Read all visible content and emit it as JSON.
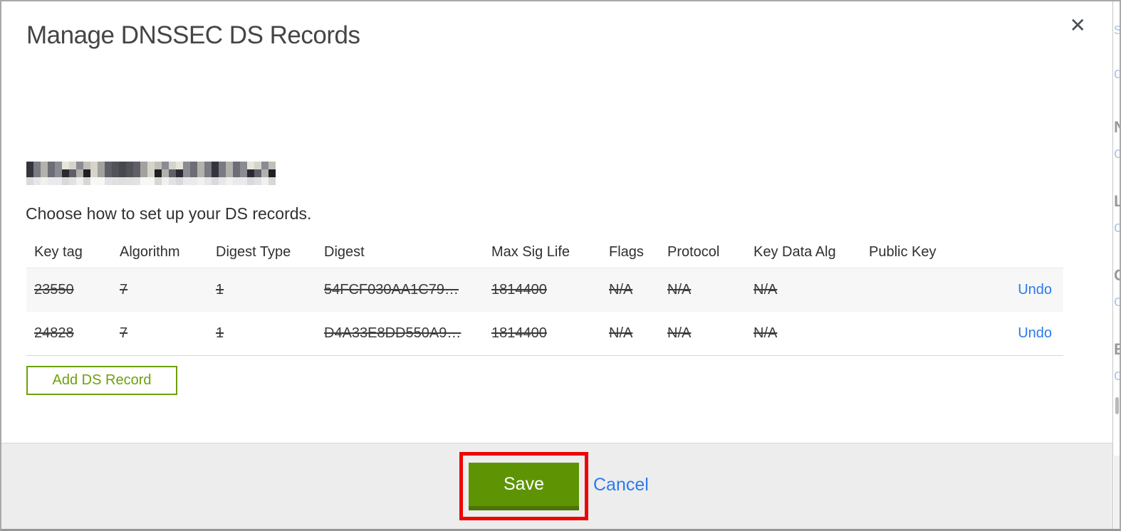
{
  "modal": {
    "title": "Manage DNSSEC DS Records",
    "close_glyph": "✕",
    "subtitle": "Choose how to set up your DS records.",
    "domain": {
      "redacted": true
    },
    "table": {
      "columns": [
        "Key tag",
        "Algorithm",
        "Digest Type",
        "Digest",
        "Max Sig Life",
        "Flags",
        "Protocol",
        "Key Data Alg",
        "Public Key"
      ],
      "rows": [
        {
          "cells": [
            "23550",
            "7",
            "1",
            "54FCF030AA1C79…",
            "1814400",
            "N/A",
            "N/A",
            "N/A",
            ""
          ],
          "action": "Undo",
          "struck": true
        },
        {
          "cells": [
            "24828",
            "7",
            "1",
            "D4A33E8DD550A9…",
            "1814400",
            "N/A",
            "N/A",
            "N/A",
            ""
          ],
          "action": "Undo",
          "struck": true
        }
      ]
    },
    "add_button_label": "Add DS Record",
    "footer": {
      "save_label": "Save",
      "cancel_label": "Cancel"
    }
  },
  "annotation": {
    "type": "highlight-box",
    "color": "#ee0404",
    "target": "save-button"
  },
  "background_sliver": {
    "fragments": [
      "s",
      "d",
      "N",
      "o",
      "L",
      "o",
      "C",
      "o",
      "E",
      "o"
    ]
  },
  "colors": {
    "accent_green": "#5e9404",
    "accent_green_dark": "#4a7403",
    "outline_green": "#6f9f0c",
    "link_blue": "#2b7af0",
    "row_stripe": "#f7f7f8",
    "footer_bg": "#ededed",
    "annotation_red": "#ee0404",
    "title_gray": "#454545"
  }
}
